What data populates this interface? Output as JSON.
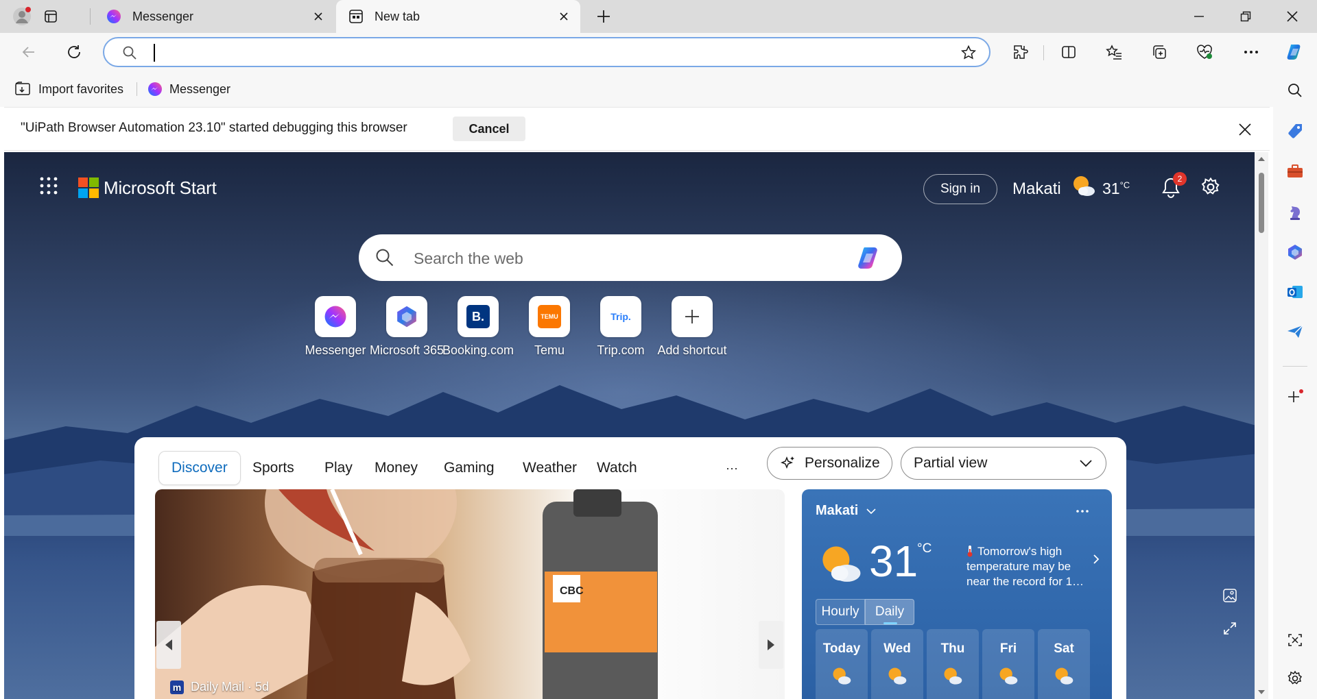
{
  "tabs": [
    {
      "title": "Messenger",
      "active": false
    },
    {
      "title": "New tab",
      "active": true
    }
  ],
  "toolbar": {
    "address_value": "",
    "address_placeholder": ""
  },
  "favorites": [
    {
      "label": "Import favorites",
      "icon": "import-favorites-icon"
    },
    {
      "label": "Messenger",
      "icon": "messenger-icon"
    }
  ],
  "infobar": {
    "message": "\"UiPath Browser Automation 23.10\" started debugging this browser",
    "cancel_label": "Cancel"
  },
  "ms_start": {
    "brand": "Microsoft Start",
    "signin_label": "Sign in",
    "city": "Makati",
    "temp": "31",
    "temp_unit": "°C",
    "notifications": "2",
    "search_placeholder": "Search the web",
    "shortcuts": [
      {
        "label": "Messenger",
        "icon": "messenger-icon"
      },
      {
        "label": "Microsoft 365",
        "icon": "microsoft-365-icon"
      },
      {
        "label": "Booking.com",
        "icon": "booking-icon",
        "glyph": "B."
      },
      {
        "label": "Temu",
        "icon": "temu-icon",
        "glyph": "TEMU"
      },
      {
        "label": "Trip.com",
        "icon": "trip-icon",
        "glyph": "Trip."
      },
      {
        "label": "Add shortcut",
        "icon": "plus-icon"
      }
    ]
  },
  "feed": {
    "nav": [
      "Discover",
      "Sports",
      "Play",
      "Money",
      "Gaming",
      "Weather",
      "Watch"
    ],
    "more_label": "···",
    "personalize_label": "Personalize",
    "view_label": "Partial view",
    "hero": {
      "source": "Daily Mail · 5d",
      "source_glyph": "m"
    },
    "weather": {
      "city": "Makati",
      "temp": "31",
      "unit": "°C",
      "message": "Tomorrow's high temperature may be near the record for 1…",
      "tabs": [
        "Hourly",
        "Daily"
      ],
      "active_tab": "Daily",
      "days": [
        "Today",
        "Wed",
        "Thu",
        "Fri",
        "Sat"
      ]
    }
  },
  "colors": {
    "accent": "#0f6cbd",
    "address_border": "#7aa8e6",
    "badge": "#e0352b"
  }
}
